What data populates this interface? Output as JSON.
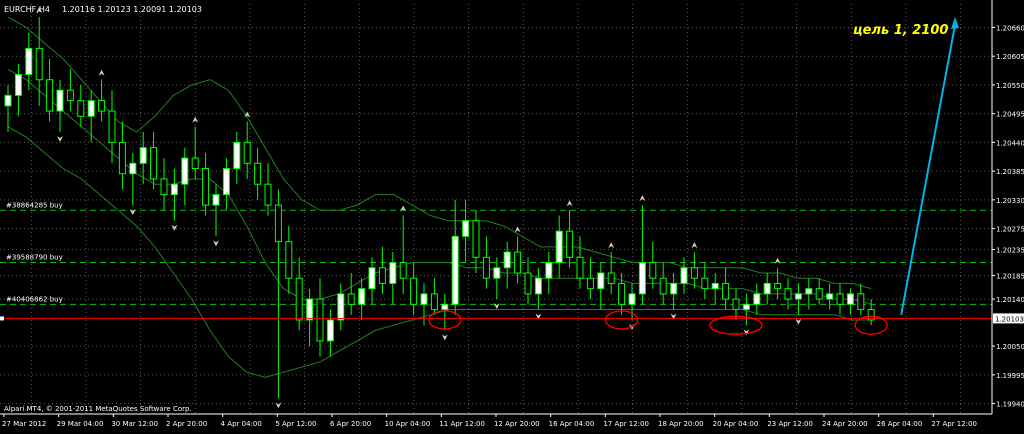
{
  "header": {
    "symbol_timeframe": "EURCHF,H4",
    "ohlc": "1.20116 1.20123 1.20091 1.20103"
  },
  "footer": {
    "copyright": "Alpari MT4, © 2001-2011 MetaQuotes Software Corp."
  },
  "annotation": {
    "target_text": "цель 1, 2100",
    "target_color": "#ffff00",
    "arrow_color": "#00b4e6",
    "ellipse_color": "#ff0000"
  },
  "colors": {
    "background": "#000000",
    "grid": "#5a5a5a",
    "candle": "#00ff00",
    "band": "#208020",
    "order_line": "#00c000",
    "current_price_line": "#ff0000",
    "axis_text": "#ffffff"
  },
  "chart_data": {
    "type": "candlestick",
    "ylim": [
      1.1992,
      1.20705
    ],
    "y_ticks": [
      "1.20660",
      "1.20605",
      "1.20550",
      "1.20495",
      "1.20440",
      "1.20385",
      "1.20330",
      "1.20275",
      "1.20235",
      "1.20185",
      "1.20140",
      "1.20050",
      "1.19995",
      "1.19940"
    ],
    "current_price": "1.20103",
    "x_ticks": [
      "27 Mar 2012",
      "29 Mar 04:00",
      "30 Mar 12:00",
      "2 Apr 20:00",
      "4 Apr 04:00",
      "5 Apr 12:00",
      "6 Apr 20:00",
      "10 Apr 04:00",
      "11 Apr 12:00",
      "12 Apr 20:00",
      "16 Apr 04:00",
      "17 Apr 12:00",
      "18 Apr 20:00",
      "20 Apr 04:00",
      "23 Apr 12:00",
      "24 Apr 20:00",
      "26 Apr 04:00",
      "27 Apr 12:00"
    ],
    "order_lines": [
      {
        "label": "#38864285 buy",
        "price": 1.2031
      },
      {
        "label": "#39588790 buy",
        "price": 1.2021
      },
      {
        "label": "#40406862 buy",
        "price": 1.2013
      }
    ],
    "candles": [
      {
        "o": 1.2051,
        "h": 1.2055,
        "l": 1.2046,
        "c": 1.2053
      },
      {
        "o": 1.2053,
        "h": 1.2059,
        "l": 1.2049,
        "c": 1.2057
      },
      {
        "o": 1.2057,
        "h": 1.2065,
        "l": 1.2054,
        "c": 1.2062
      },
      {
        "o": 1.2062,
        "h": 1.2068,
        "l": 1.2051,
        "c": 1.2056
      },
      {
        "o": 1.2056,
        "h": 1.206,
        "l": 1.2048,
        "c": 1.205
      },
      {
        "o": 1.205,
        "h": 1.2056,
        "l": 1.2046,
        "c": 1.2054
      },
      {
        "o": 1.2054,
        "h": 1.2058,
        "l": 1.205,
        "c": 1.2052
      },
      {
        "o": 1.2052,
        "h": 1.2055,
        "l": 1.2047,
        "c": 1.2049
      },
      {
        "o": 1.2049,
        "h": 1.2054,
        "l": 1.2044,
        "c": 1.2052
      },
      {
        "o": 1.2052,
        "h": 1.2056,
        "l": 1.2048,
        "c": 1.205
      },
      {
        "o": 1.205,
        "h": 1.2054,
        "l": 1.204,
        "c": 1.2044
      },
      {
        "o": 1.2044,
        "h": 1.2048,
        "l": 1.2035,
        "c": 1.2038
      },
      {
        "o": 1.2038,
        "h": 1.2042,
        "l": 1.2032,
        "c": 1.204
      },
      {
        "o": 1.204,
        "h": 1.2046,
        "l": 1.2036,
        "c": 1.2043
      },
      {
        "o": 1.2043,
        "h": 1.2046,
        "l": 1.2035,
        "c": 1.2037
      },
      {
        "o": 1.2037,
        "h": 1.2041,
        "l": 1.2031,
        "c": 1.2034
      },
      {
        "o": 1.2034,
        "h": 1.2039,
        "l": 1.2029,
        "c": 1.2036
      },
      {
        "o": 1.2036,
        "h": 1.2043,
        "l": 1.2032,
        "c": 1.2041
      },
      {
        "o": 1.2041,
        "h": 1.2047,
        "l": 1.2037,
        "c": 1.2039
      },
      {
        "o": 1.2039,
        "h": 1.2042,
        "l": 1.203,
        "c": 1.2032
      },
      {
        "o": 1.2032,
        "h": 1.2036,
        "l": 1.2026,
        "c": 1.2034
      },
      {
        "o": 1.2034,
        "h": 1.2041,
        "l": 1.2031,
        "c": 1.2039
      },
      {
        "o": 1.2039,
        "h": 1.2046,
        "l": 1.2036,
        "c": 1.2044
      },
      {
        "o": 1.2044,
        "h": 1.2048,
        "l": 1.2037,
        "c": 1.204
      },
      {
        "o": 1.204,
        "h": 1.2043,
        "l": 1.2033,
        "c": 1.2036
      },
      {
        "o": 1.2036,
        "h": 1.204,
        "l": 1.203,
        "c": 1.2032
      },
      {
        "o": 1.2032,
        "h": 1.2035,
        "l": 1.1995,
        "c": 1.2025
      },
      {
        "o": 1.2025,
        "h": 1.2028,
        "l": 1.2015,
        "c": 1.2018
      },
      {
        "o": 1.2018,
        "h": 1.2022,
        "l": 1.2008,
        "c": 1.201
      },
      {
        "o": 1.201,
        "h": 1.2016,
        "l": 1.2005,
        "c": 1.2014
      },
      {
        "o": 1.2014,
        "h": 1.2018,
        "l": 1.2003,
        "c": 1.2006
      },
      {
        "o": 1.2006,
        "h": 1.2012,
        "l": 1.2003,
        "c": 1.201
      },
      {
        "o": 1.201,
        "h": 1.2017,
        "l": 1.2008,
        "c": 1.2015
      },
      {
        "o": 1.2015,
        "h": 1.2019,
        "l": 1.2011,
        "c": 1.2013
      },
      {
        "o": 1.2013,
        "h": 1.2018,
        "l": 1.201,
        "c": 1.2016
      },
      {
        "o": 1.2016,
        "h": 1.2022,
        "l": 1.2013,
        "c": 1.202
      },
      {
        "o": 1.202,
        "h": 1.2024,
        "l": 1.2015,
        "c": 1.2017
      },
      {
        "o": 1.2017,
        "h": 1.2023,
        "l": 1.2013,
        "c": 1.2021
      },
      {
        "o": 1.2021,
        "h": 1.203,
        "l": 1.2015,
        "c": 1.2018
      },
      {
        "o": 1.2018,
        "h": 1.2021,
        "l": 1.2011,
        "c": 1.2013
      },
      {
        "o": 1.2013,
        "h": 1.2017,
        "l": 1.2009,
        "c": 1.2015
      },
      {
        "o": 1.2015,
        "h": 1.2018,
        "l": 1.2011,
        "c": 1.2012
      },
      {
        "o": 1.2012,
        "h": 1.2015,
        "l": 1.2008,
        "c": 1.2013
      },
      {
        "o": 1.2013,
        "h": 1.2033,
        "l": 1.2011,
        "c": 1.2026
      },
      {
        "o": 1.2026,
        "h": 1.2033,
        "l": 1.2021,
        "c": 1.2029
      },
      {
        "o": 1.2029,
        "h": 1.2031,
        "l": 1.2019,
        "c": 1.2022
      },
      {
        "o": 1.2022,
        "h": 1.2026,
        "l": 1.2016,
        "c": 1.2018
      },
      {
        "o": 1.2018,
        "h": 1.2022,
        "l": 1.2014,
        "c": 1.202
      },
      {
        "o": 1.202,
        "h": 1.2025,
        "l": 1.2016,
        "c": 1.2023
      },
      {
        "o": 1.2023,
        "h": 1.2026,
        "l": 1.2017,
        "c": 1.2019
      },
      {
        "o": 1.2019,
        "h": 1.2022,
        "l": 1.2013,
        "c": 1.2015
      },
      {
        "o": 1.2015,
        "h": 1.202,
        "l": 1.2012,
        "c": 1.2018
      },
      {
        "o": 1.2018,
        "h": 1.2023,
        "l": 1.2015,
        "c": 1.2021
      },
      {
        "o": 1.2021,
        "h": 1.203,
        "l": 1.2018,
        "c": 1.2027
      },
      {
        "o": 1.2027,
        "h": 1.2031,
        "l": 1.202,
        "c": 1.2022
      },
      {
        "o": 1.2022,
        "h": 1.2026,
        "l": 1.2016,
        "c": 1.2018
      },
      {
        "o": 1.2018,
        "h": 1.2022,
        "l": 1.2014,
        "c": 1.2016
      },
      {
        "o": 1.2016,
        "h": 1.2021,
        "l": 1.2012,
        "c": 1.2019
      },
      {
        "o": 1.2019,
        "h": 1.2023,
        "l": 1.2015,
        "c": 1.2017
      },
      {
        "o": 1.2017,
        "h": 1.2019,
        "l": 1.2011,
        "c": 1.2013
      },
      {
        "o": 1.2013,
        "h": 1.2017,
        "l": 1.201,
        "c": 1.2015
      },
      {
        "o": 1.2015,
        "h": 1.2032,
        "l": 1.2013,
        "c": 1.2021
      },
      {
        "o": 1.2021,
        "h": 1.2025,
        "l": 1.2016,
        "c": 1.2018
      },
      {
        "o": 1.2018,
        "h": 1.2021,
        "l": 1.2013,
        "c": 1.2015
      },
      {
        "o": 1.2015,
        "h": 1.2019,
        "l": 1.2012,
        "c": 1.2017
      },
      {
        "o": 1.2017,
        "h": 1.2022,
        "l": 1.2015,
        "c": 1.202
      },
      {
        "o": 1.202,
        "h": 1.2023,
        "l": 1.2016,
        "c": 1.2018
      },
      {
        "o": 1.2018,
        "h": 1.2021,
        "l": 1.2014,
        "c": 1.2016
      },
      {
        "o": 1.2016,
        "h": 1.2019,
        "l": 1.2013,
        "c": 1.2017
      },
      {
        "o": 1.2017,
        "h": 1.202,
        "l": 1.2012,
        "c": 1.2014
      },
      {
        "o": 1.2014,
        "h": 1.2016,
        "l": 1.201,
        "c": 1.2012
      },
      {
        "o": 1.2012,
        "h": 1.2015,
        "l": 1.2009,
        "c": 1.2013
      },
      {
        "o": 1.2013,
        "h": 1.2017,
        "l": 1.2011,
        "c": 1.2015
      },
      {
        "o": 1.2015,
        "h": 1.2019,
        "l": 1.2013,
        "c": 1.2017
      },
      {
        "o": 1.2017,
        "h": 1.202,
        "l": 1.2014,
        "c": 1.2016
      },
      {
        "o": 1.2016,
        "h": 1.2018,
        "l": 1.2012,
        "c": 1.2014
      },
      {
        "o": 1.2014,
        "h": 1.2017,
        "l": 1.2011,
        "c": 1.2015
      },
      {
        "o": 1.2015,
        "h": 1.2018,
        "l": 1.2012,
        "c": 1.2016
      },
      {
        "o": 1.2016,
        "h": 1.2018,
        "l": 1.2013,
        "c": 1.2014
      },
      {
        "o": 1.2014,
        "h": 1.2017,
        "l": 1.2012,
        "c": 1.2015
      },
      {
        "o": 1.2015,
        "h": 1.2017,
        "l": 1.2011,
        "c": 1.2013
      },
      {
        "o": 1.2013,
        "h": 1.2016,
        "l": 1.2011,
        "c": 1.2015
      },
      {
        "o": 1.2015,
        "h": 1.2017,
        "l": 1.2011,
        "c": 1.2012
      },
      {
        "o": 1.2012,
        "h": 1.2014,
        "l": 1.2009,
        "c": 1.201
      }
    ],
    "bands": {
      "upper": [
        1.2068,
        1.2066,
        1.2063,
        1.206,
        1.2056,
        1.2052,
        1.2048,
        1.2046,
        1.2049,
        1.2053,
        1.2055,
        1.2056,
        1.2054,
        1.2049,
        1.2043,
        1.2037,
        1.2033,
        1.2031,
        1.2031,
        1.2032,
        1.2034,
        1.2034,
        1.2032,
        1.203,
        1.2029,
        1.2029,
        1.2029,
        1.2028,
        1.2026,
        1.2024,
        1.2024,
        1.2024,
        1.2023,
        1.2022,
        1.2021,
        1.2021,
        1.2021,
        1.202,
        1.202,
        1.202,
        1.202,
        1.2019,
        1.2019,
        1.2018,
        1.2018,
        1.2017,
        1.2017,
        1.2016
      ],
      "middle": [
        1.2058,
        1.2056,
        1.2053,
        1.205,
        1.2047,
        1.2044,
        1.2041,
        1.2038,
        1.2036,
        1.2036,
        1.2037,
        1.2037,
        1.2034,
        1.2028,
        1.2021,
        1.2016,
        1.2014,
        1.2014,
        1.2015,
        1.2017,
        1.2019,
        1.202,
        1.2021,
        1.2021,
        1.2021,
        1.202,
        1.202,
        1.2019,
        1.2019,
        1.2018,
        1.2018,
        1.2018,
        1.2018,
        1.2018,
        1.2017,
        1.2017,
        1.2017,
        1.2017,
        1.2016,
        1.2016,
        1.2016,
        1.2015,
        1.2015,
        1.2015,
        1.2015,
        1.2014,
        1.2014,
        1.2013
      ],
      "lower": [
        1.2047,
        1.2045,
        1.2042,
        1.2039,
        1.2037,
        1.2034,
        1.2031,
        1.2028,
        1.2024,
        1.2019,
        1.2014,
        1.2008,
        1.2003,
        1.2,
        1.1999,
        1.2,
        1.2001,
        1.2002,
        1.2004,
        1.2006,
        1.2008,
        1.2009,
        1.201,
        1.2011,
        1.2012,
        1.2012,
        1.2012,
        1.2012,
        1.2012,
        1.2012,
        1.2012,
        1.2012,
        1.2012,
        1.2012,
        1.2012,
        1.2012,
        1.2012,
        1.2012,
        1.2012,
        1.2012,
        1.2012,
        1.2011,
        1.2011,
        1.2011,
        1.2011,
        1.2011,
        1.201,
        1.201
      ]
    },
    "target_arrow": {
      "from_price": 1.2011,
      "to_price": 1.2068
    },
    "ellipse_marks": [
      {
        "candle_index": 42,
        "price": 1.201
      },
      {
        "candle_index": 59,
        "price": 1.201
      },
      {
        "candle_index": 70,
        "price": 1.2009
      },
      {
        "candle_index": 83,
        "price": 1.2009
      }
    ]
  }
}
